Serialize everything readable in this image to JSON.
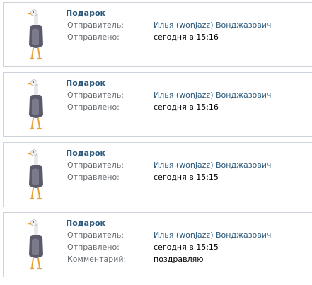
{
  "colors": {
    "link": "#2b587a",
    "label": "#666b70",
    "border": "#cdd3da",
    "text": "#000000"
  },
  "gifts": [
    {
      "icon": "ostrich-gift-icon",
      "title": "Подарок",
      "sender_label": "Отправитель:",
      "sender": "Илья (wonjazz) Вонджазович",
      "sent_label": "Отправлено:",
      "sent": "сегодня в 15:16"
    },
    {
      "icon": "ostrich-gift-icon",
      "title": "Подарок",
      "sender_label": "Отправитель:",
      "sender": "Илья (wonjazz) Вонджазович",
      "sent_label": "Отправлено:",
      "sent": "сегодня в 15:16"
    },
    {
      "icon": "ostrich-gift-icon",
      "title": "Подарок",
      "sender_label": "Отправитель:",
      "sender": "Илья (wonjazz) Вонджазович",
      "sent_label": "Отправлено:",
      "sent": "сегодня в 15:15"
    },
    {
      "icon": "ostrich-gift-icon",
      "title": "Подарок",
      "sender_label": "Отправитель:",
      "sender": "Илья (wonjazz) Вонджазович",
      "sent_label": "Отправлено:",
      "sent": "сегодня в 15:15",
      "comment_label": "Комментарий:",
      "comment": "поздравляю"
    }
  ]
}
